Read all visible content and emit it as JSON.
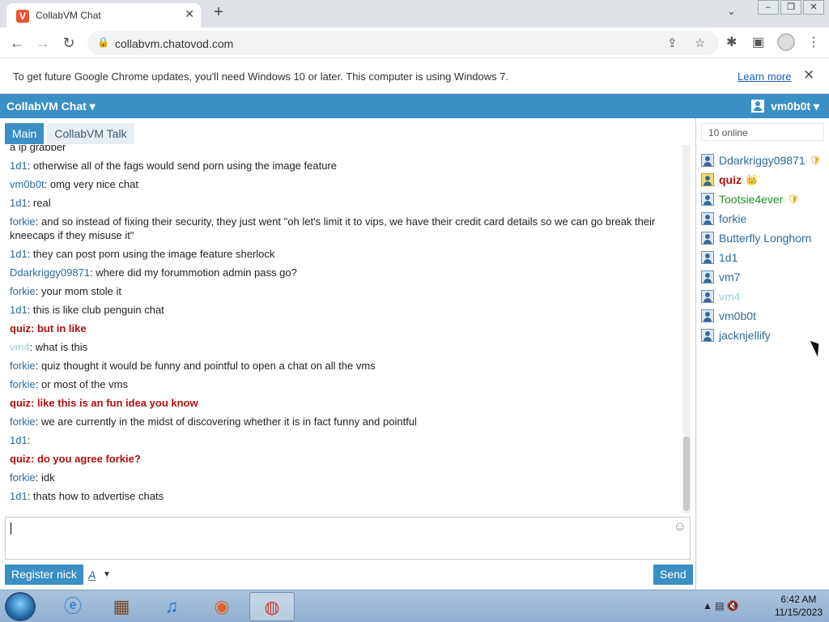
{
  "browser": {
    "tab_title": "CollabVM Chat",
    "tab_favicon": "V",
    "url": "collabvm.chatovod.com",
    "infobar_message": "To get future Google Chrome updates, you'll need Windows 10 or later. This computer is using Windows 7.",
    "infobar_link": "Learn more"
  },
  "app": {
    "brand": "CollabVM Chat ▾",
    "current_user": "vm0b0t ▾",
    "tabs": [
      "Main",
      "CollabVM Talk"
    ]
  },
  "messages": [
    {
      "nick": "",
      "text": "a ip grabber",
      "nick_color": "#2d6a9a",
      "text_color": "#222",
      "bold": false
    },
    {
      "nick": "1d1",
      "text": ": otherwise all of the fags would send porn using the image feature",
      "nick_color": "#2d6a9a",
      "text_color": "#222",
      "bold": false
    },
    {
      "nick": "vm0b0t",
      "text": ": omg very nice chat",
      "nick_color": "#2d6a9a",
      "text_color": "#222",
      "bold": false
    },
    {
      "nick": "1d1",
      "text": ": real",
      "nick_color": "#2d6a9a",
      "text_color": "#222",
      "bold": false
    },
    {
      "nick": "forkie",
      "text": ": and so instead of fixing their security, they just went \"oh let's limit it to vips, we have their credit card details so we can go break their kneecaps if they misuse it\"",
      "nick_color": "#2d6a9a",
      "text_color": "#222",
      "bold": false
    },
    {
      "nick": "1d1",
      "text": ": they can post porn using the image feature sherlock",
      "nick_color": "#2d6a9a",
      "text_color": "#222",
      "bold": false
    },
    {
      "nick": "Ddarkriggy09871",
      "text": ": where did my forummotion admin pass go?",
      "nick_color": "#2d6a9a",
      "text_color": "#222",
      "bold": false
    },
    {
      "nick": "forkie",
      "text": ": your mom stole it",
      "nick_color": "#2d6a9a",
      "text_color": "#222",
      "bold": false
    },
    {
      "nick": "1d1",
      "text": ": this is like club penguin chat",
      "nick_color": "#2d6a9a",
      "text_color": "#222",
      "bold": false
    },
    {
      "nick": "quiz",
      "text": ": but in like",
      "nick_color": "#b01010",
      "text_color": "#b01010",
      "bold": true
    },
    {
      "nick": "vm4",
      "text": ": what is this",
      "nick_color": "#9ad4e0",
      "text_color": "#222",
      "bold": false
    },
    {
      "nick": "forkie",
      "text": ": quiz thought it would be funny and pointful to open a chat on all the vms",
      "nick_color": "#2d6a9a",
      "text_color": "#222",
      "bold": false
    },
    {
      "nick": "forkie",
      "text": ": or most of the vms",
      "nick_color": "#2d6a9a",
      "text_color": "#222",
      "bold": false
    },
    {
      "nick": "quiz",
      "text": ": like this is an fun idea you know",
      "nick_color": "#b01010",
      "text_color": "#b01010",
      "bold": true
    },
    {
      "nick": "forkie",
      "text": ": we are currently in the midst of discovering whether it is in fact funny and pointful",
      "nick_color": "#2d6a9a",
      "text_color": "#222",
      "bold": false
    },
    {
      "nick": "1d1",
      "text": ":",
      "nick_color": "#2d6a9a",
      "text_color": "#222",
      "bold": false
    },
    {
      "nick": "quiz",
      "text": ": do you agree forkie?",
      "nick_color": "#b01010",
      "text_color": "#b01010",
      "bold": true
    },
    {
      "nick": "forkie",
      "text": ": idk",
      "nick_color": "#2d6a9a",
      "text_color": "#222",
      "bold": false
    },
    {
      "nick": "1d1",
      "text": ": thats how to advertise chats",
      "nick_color": "#2d6a9a",
      "text_color": "#222",
      "bold": false
    }
  ],
  "composer": {
    "register_label": "Register nick",
    "font_label": "A",
    "send_label": "Send"
  },
  "users": {
    "online_label": "10 online",
    "list": [
      {
        "name": "Ddarkriggy09871",
        "color": "#2d6a9a",
        "badge": "shield",
        "badge_glyph": "🛡",
        "gold": false,
        "bold": false
      },
      {
        "name": "quiz",
        "color": "#b01010",
        "badge": "crown",
        "badge_glyph": "👑",
        "gold": true,
        "bold": true
      },
      {
        "name": "Tootsie4ever",
        "color": "#2a8a2a",
        "badge": "shield",
        "badge_glyph": "🛡",
        "gold": false,
        "bold": false
      },
      {
        "name": "forkie",
        "color": "#2d6a9a",
        "badge": "",
        "badge_glyph": "",
        "gold": false,
        "bold": false
      },
      {
        "name": "Butterfly Longhorn",
        "color": "#2d6a9a",
        "badge": "",
        "badge_glyph": "",
        "gold": false,
        "bold": false
      },
      {
        "name": "1d1",
        "color": "#2d6a9a",
        "badge": "",
        "badge_glyph": "",
        "gold": false,
        "bold": false
      },
      {
        "name": "vm7",
        "color": "#2d6a9a",
        "badge": "",
        "badge_glyph": "",
        "gold": false,
        "bold": false
      },
      {
        "name": "vm4",
        "color": "#9ad4e0",
        "badge": "",
        "badge_glyph": "",
        "gold": false,
        "bold": false
      },
      {
        "name": "vm0b0t",
        "color": "#2d6a9a",
        "badge": "",
        "badge_glyph": "",
        "gold": false,
        "bold": false
      },
      {
        "name": "jacknjellify",
        "color": "#2d6a9a",
        "badge": "",
        "badge_glyph": "",
        "gold": false,
        "bold": false
      }
    ]
  },
  "taskbar": {
    "time": "6:42 AM",
    "date": "11/15/2023"
  }
}
